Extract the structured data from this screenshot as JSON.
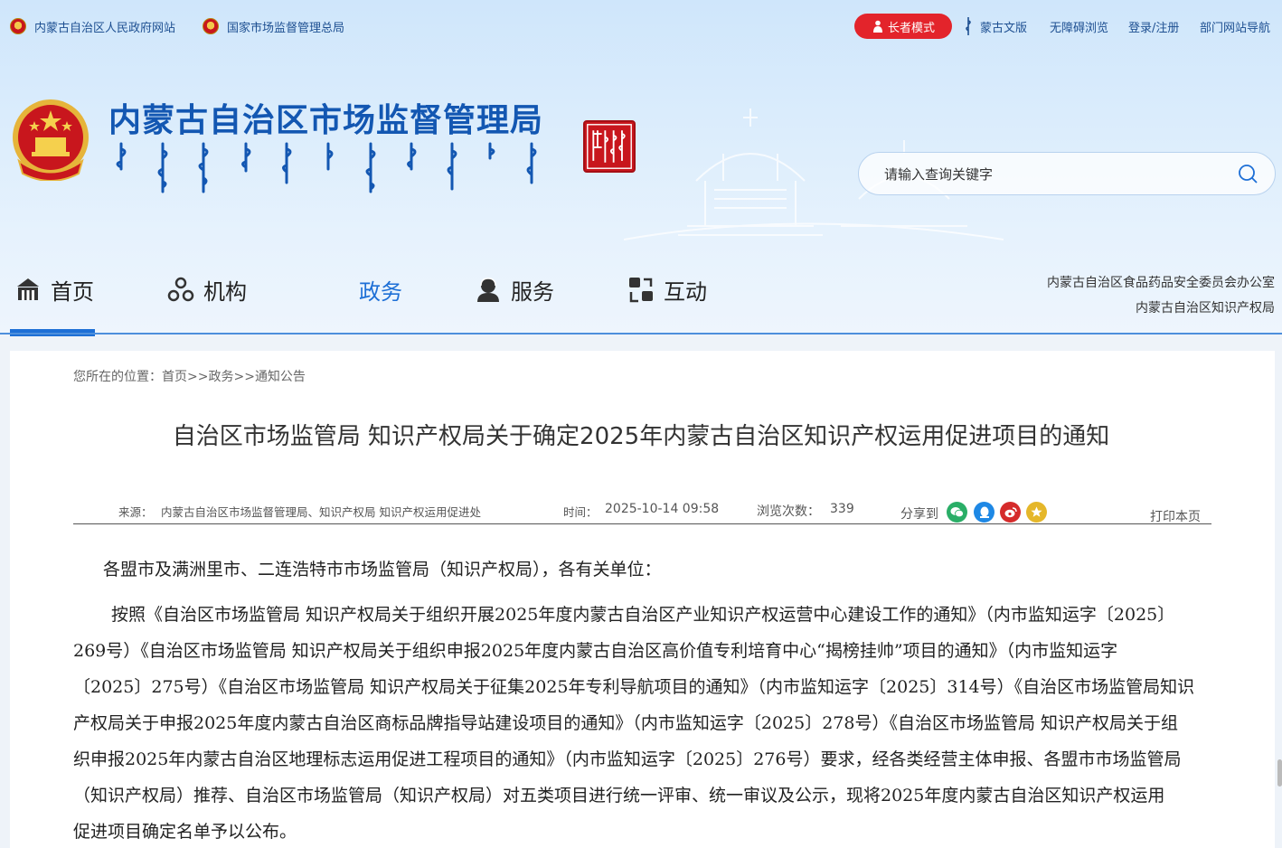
{
  "topbar": {
    "gov_site": "内蒙古自治区人民政府网站",
    "samr_site": "国家市场监督管理总局",
    "elder_mode": "长者模式",
    "mongol_version": "蒙古文版",
    "accessible": "无障碍浏览",
    "login": "登录/注册",
    "dept_nav": "部门网站导航"
  },
  "logo": {
    "site_title": "内蒙古自治区市场监督管理局"
  },
  "search": {
    "placeholder": "请输入查询关键字"
  },
  "nav": {
    "items": [
      {
        "label": "首页",
        "icon": "home-icon"
      },
      {
        "label": "机构",
        "icon": "organization-icon"
      },
      {
        "label": "政务",
        "icon": ""
      },
      {
        "label": "服务",
        "icon": "service-icon"
      },
      {
        "label": "互动",
        "icon": "interaction-icon"
      }
    ],
    "right_links": [
      "内蒙古自治区食品药品安全委员会办公室",
      "内蒙古自治区知识产权局"
    ]
  },
  "breadcrumb": {
    "prefix": "您所在的位置：",
    "home": "首页",
    "sep": ">>",
    "level1": "政务",
    "level2": "通知公告"
  },
  "article": {
    "title": "自治区市场监管局 知识产权局关于确定2025年内蒙古自治区知识产权运用促进项目的通知",
    "source_label": "来源：",
    "source": "内蒙古自治区市场监督管理局、知识产权局 知识产权运用促进处",
    "time_label": "时间：",
    "time": "2025-10-14 09:58",
    "views_label": "浏览次数：",
    "views": "339",
    "share_label": "分享到",
    "print": "打印本页",
    "greeting": "各盟市及满洲里市、二连浩特市市场监管局（知识产权局），各有关单位：",
    "body_lines": [
      "按照《自治区市场监管局 知识产权局关于组织开展2025年度内蒙古自治区产业知识产权运营中心建设工作的通知》（内市监知运字〔2025〕",
      "269号）《自治区市场监管局 知识产权局关于组织申报2025年度内蒙古自治区高价值专利培育中心“揭榜挂帅”项目的通知》（内市监知运字",
      "〔2025〕275号）《自治区市场监管局 知识产权局关于征集2025年专利导航项目的通知》（内市监知运字〔2025〕314号）《自治区市场监管局知识",
      "产权局关于申报2025年度内蒙古自治区商标品牌指导站建设项目的通知》（内市监知运字〔2025〕278号）《自治区市场监管局 知识产权局关于组",
      "织申报2025年内蒙古自治区地理标志运用促进工程项目的通知》（内市监知运字〔2025〕276号）要求，经各类经营主体申报、各盟市市场监管局",
      "（知识产权局）推荐、自治区市场监管局（知识产权局）对五类项目进行统一评审、统一审议及公示，现将2025年度内蒙古自治区知识产权运用",
      "促进项目确定名单予以公布。"
    ]
  },
  "colors": {
    "brand_blue": "#1357b2",
    "nav_active": "#1d6fd6",
    "elder_red": "#e3242b",
    "wechat_green": "#2aae67",
    "qq_blue": "#1e88e5",
    "weibo_red": "#d52b2b",
    "favorite_yellow": "#e5b72a"
  }
}
